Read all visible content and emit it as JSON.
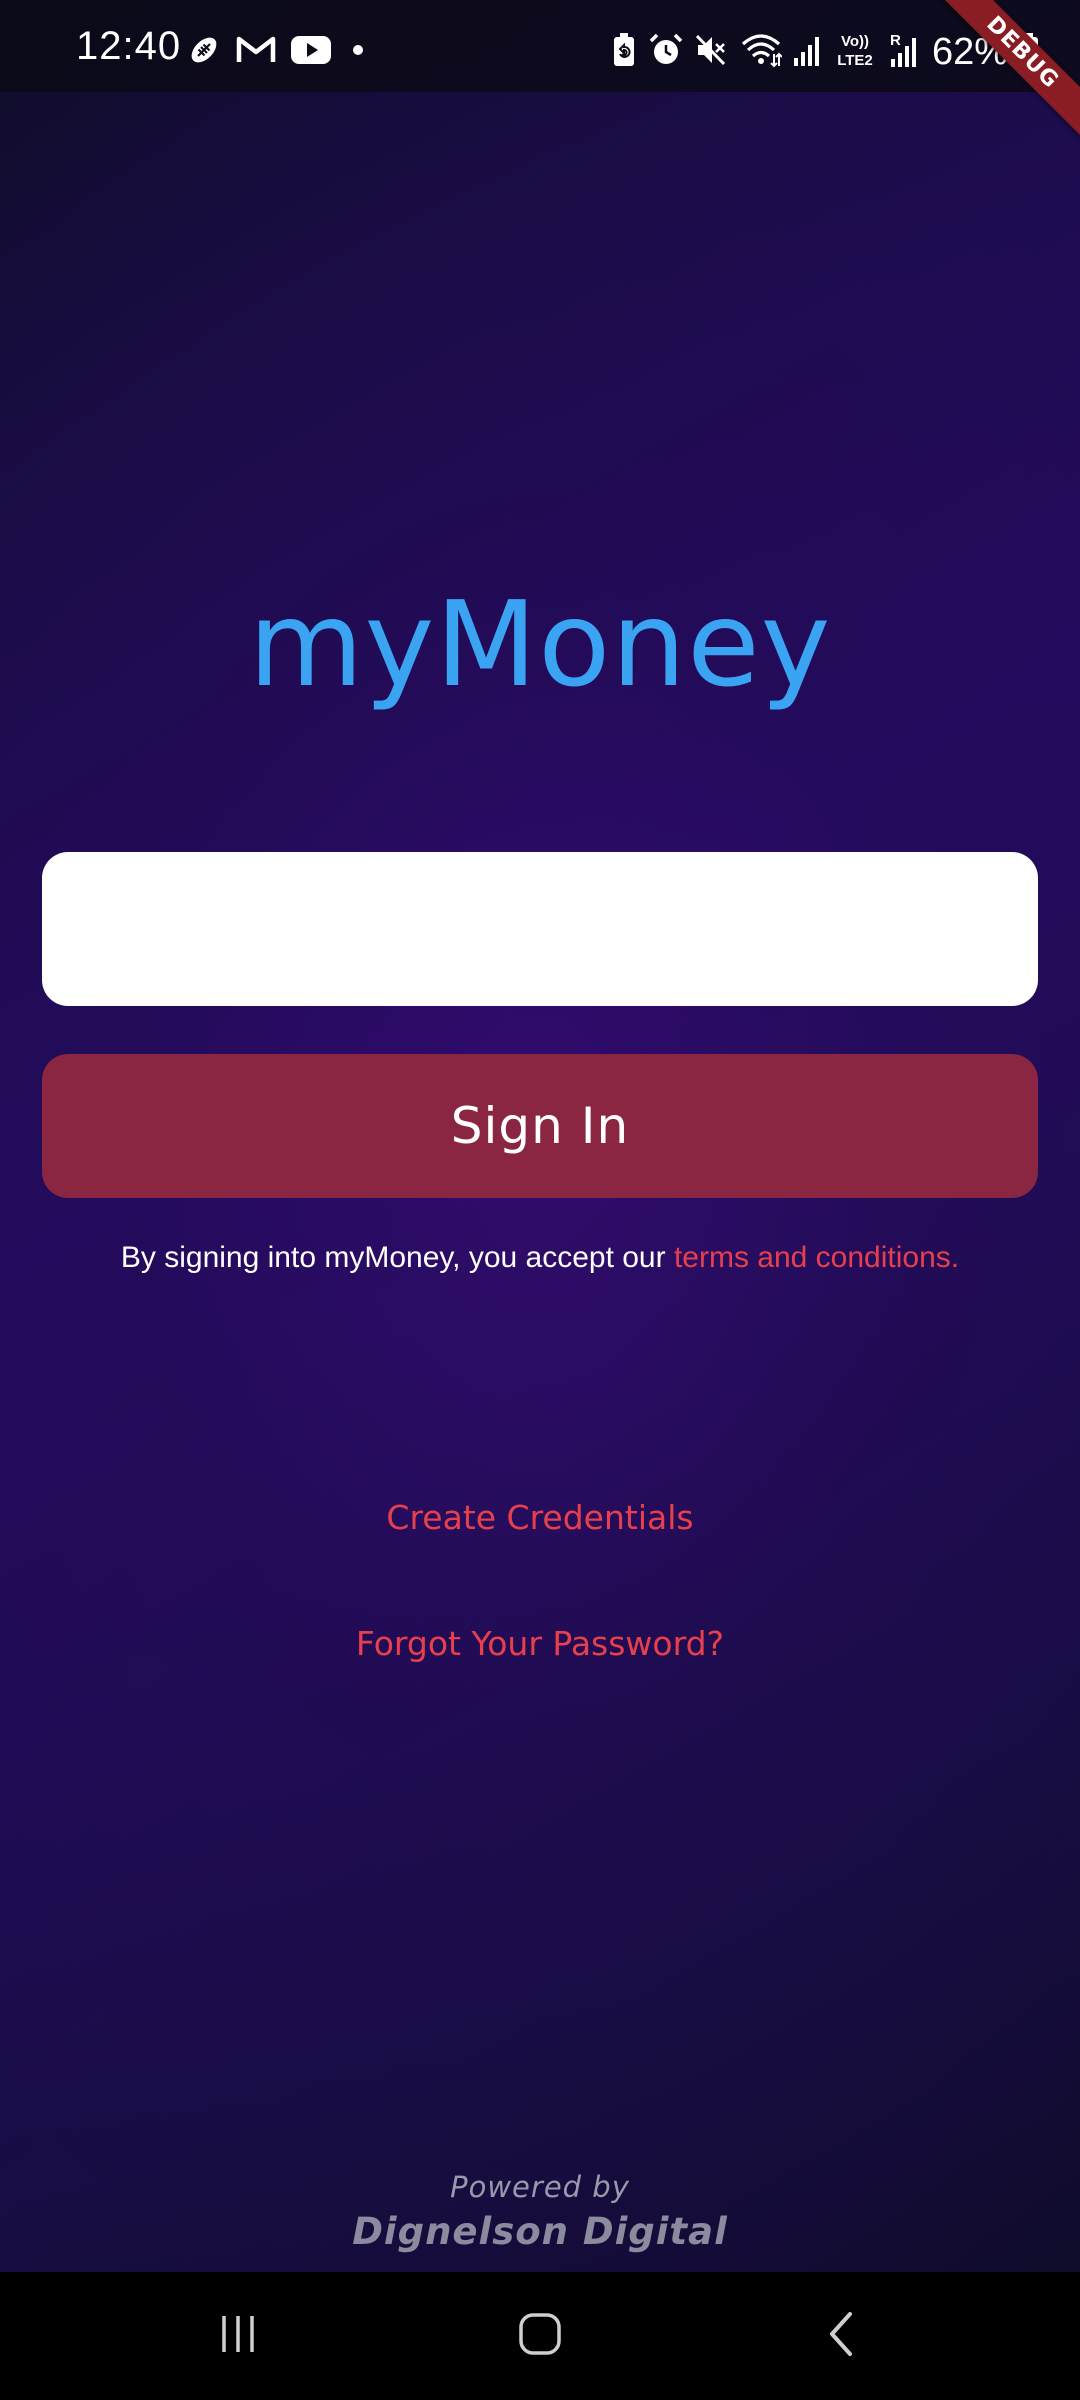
{
  "status_bar": {
    "time": "12:40",
    "battery_percent": "62%",
    "left_icons": [
      "football-icon",
      "gmail-icon",
      "youtube-icon",
      "notification-dot-icon"
    ],
    "right_icons": [
      "battery-saver-icon",
      "alarm-icon",
      "mute-icon",
      "wifi-icon",
      "signal-icon",
      "volte-lte2-icon",
      "roaming-signal-icon",
      "battery-icon"
    ],
    "volte_label_top": "Vo))",
    "volte_label_bottom": "LTE2",
    "roaming_label": "R"
  },
  "debug_banner": {
    "label": "DEBUG",
    "color": "#8a1c23"
  },
  "app": {
    "title": "myMoney",
    "title_color": "#3aa3f2"
  },
  "login_form": {
    "input_value": "",
    "input_placeholder": "",
    "signin_label": "Sign In",
    "signin_color": "#8a2542",
    "terms_prefix": "By signing into myMoney, you accept our ",
    "terms_link": "terms and conditions.",
    "link_color": "#e7404c"
  },
  "links": {
    "create_credentials": "Create Credentials",
    "forgot_password": "Forgot Your Password?"
  },
  "footer": {
    "powered_by": "Powered by",
    "company": "Dignelson Digital"
  },
  "nav_bar": {
    "buttons": [
      "recents-icon",
      "home-icon",
      "back-icon"
    ]
  }
}
